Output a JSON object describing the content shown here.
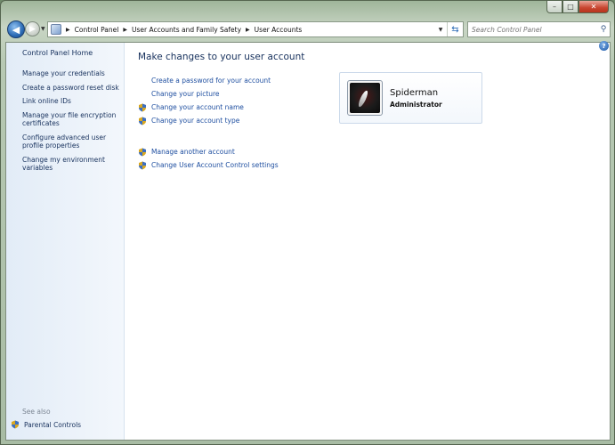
{
  "window": {
    "caption": {
      "minimize": "–",
      "maximize": "□",
      "close": "✕"
    }
  },
  "nav": {
    "back_icon": "arrow-left-icon",
    "forward_icon": "arrow-right-icon",
    "breadcrumbs": [
      "Control Panel",
      "User Accounts and Family Safety",
      "User Accounts"
    ],
    "search_placeholder": "Search Control Panel"
  },
  "sidebar": {
    "home": "Control Panel Home",
    "links": [
      "Manage your credentials",
      "Create a password reset disk",
      "Link online IDs",
      "Manage your file encryption certificates",
      "Configure advanced user profile properties",
      "Change my environment variables"
    ],
    "see_also": "See also",
    "parental_controls": "Parental Controls"
  },
  "main": {
    "title": "Make changes to your user account",
    "tasks_top": [
      {
        "label": "Create a password for your account",
        "shield": false
      },
      {
        "label": "Change your picture",
        "shield": false
      },
      {
        "label": "Change your account name",
        "shield": true
      },
      {
        "label": "Change your account type",
        "shield": true
      }
    ],
    "tasks_bottom": [
      {
        "label": "Manage another account",
        "shield": true
      },
      {
        "label": "Change User Account Control settings",
        "shield": true
      }
    ]
  },
  "user": {
    "name": "Spiderman",
    "role": "Administrator"
  },
  "colors": {
    "link": "#1f4fa0",
    "nav_text": "#16305c",
    "sidebar_bg": "#e2ecf7"
  }
}
